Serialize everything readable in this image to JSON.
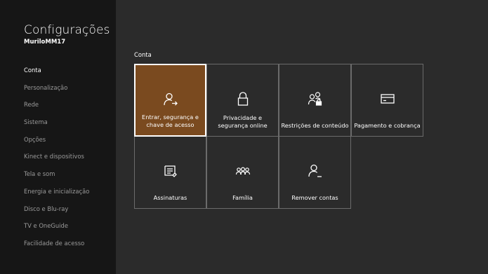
{
  "app": {
    "title": "Configurações",
    "username": "MuriloMM17"
  },
  "sidebar": {
    "items": [
      {
        "label": "Conta",
        "active": true
      },
      {
        "label": "Personalização",
        "active": false
      },
      {
        "label": "Rede",
        "active": false
      },
      {
        "label": "Sistema",
        "active": false
      },
      {
        "label": "Opções",
        "active": false
      },
      {
        "label": "Kinect e dispositivos",
        "active": false
      },
      {
        "label": "Tela e som",
        "active": false
      },
      {
        "label": "Energia e inicialização",
        "active": false
      },
      {
        "label": "Disco e Blu-ray",
        "active": false
      },
      {
        "label": "TV e OneGuide",
        "active": false
      },
      {
        "label": "Facilidade de acesso",
        "active": false
      }
    ]
  },
  "main": {
    "section_title": "Conta",
    "tiles": [
      {
        "label": "Entrar, segurança e chave de acesso",
        "icon": "person-arrow-icon",
        "selected": true
      },
      {
        "label": "Privacidade e segurança online",
        "icon": "lock-icon",
        "selected": false
      },
      {
        "label": "Restrições de conteúdo",
        "icon": "people-lock-icon",
        "selected": false
      },
      {
        "label": "Pagamento e cobrança",
        "icon": "credit-card-icon",
        "selected": false
      },
      {
        "label": "Assinaturas",
        "icon": "subscription-list-icon",
        "selected": false
      },
      {
        "label": "Família",
        "icon": "family-icon",
        "selected": false
      },
      {
        "label": "Remover contas",
        "icon": "person-remove-icon",
        "selected": false
      }
    ]
  },
  "colors": {
    "background": "#2b2b2b",
    "sidebar": "#161616",
    "selected_tile": "#7a4a1f",
    "tile_border": "#6b6b6b",
    "inactive_text": "#9a9a9a"
  }
}
